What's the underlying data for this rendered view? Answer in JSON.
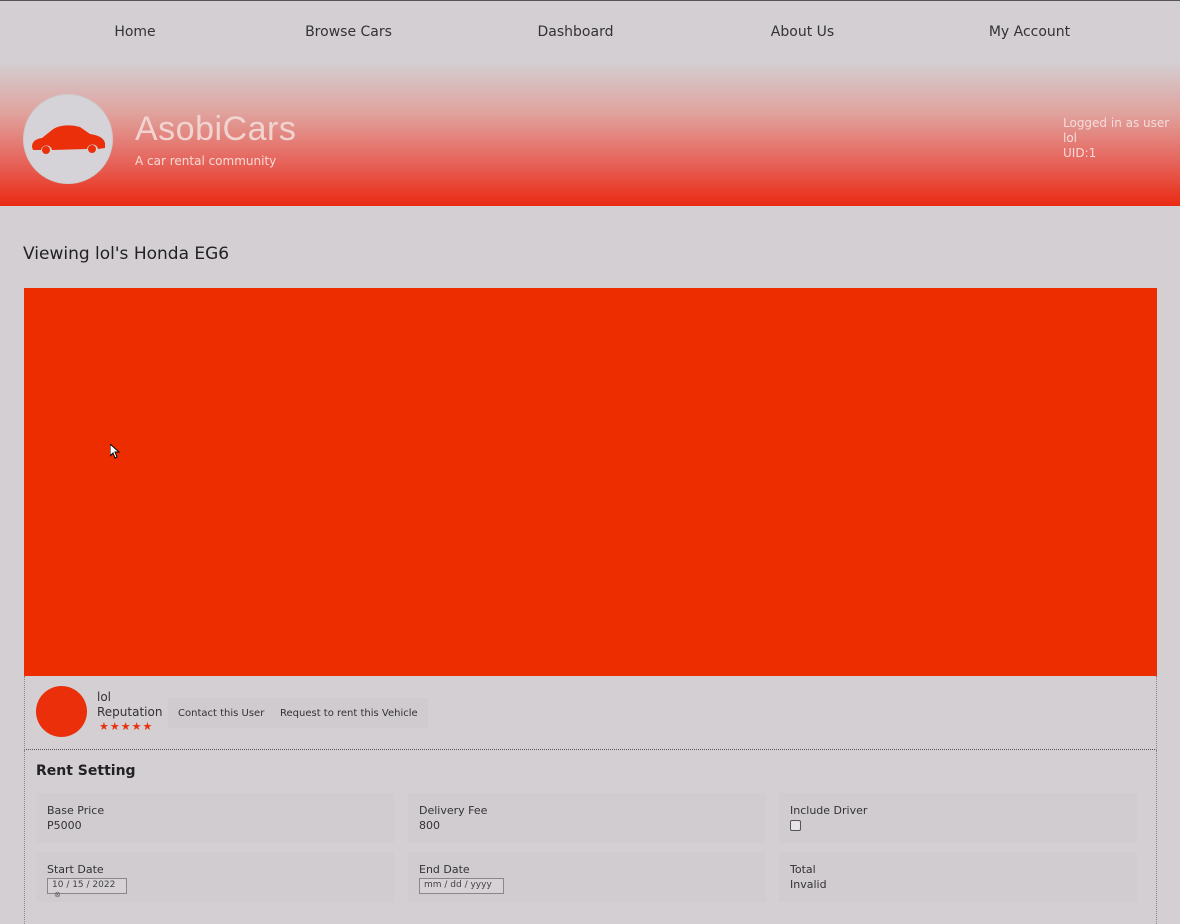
{
  "nav": {
    "items": [
      "Home",
      "Browse Cars",
      "Dashboard",
      "About Us",
      "My Account"
    ]
  },
  "brand": {
    "title": "AsobiCars",
    "tagline": "A car rental community",
    "logo_icon": "car-silhouette-icon"
  },
  "login": {
    "line1": "Logged in as user",
    "username": "lol",
    "uid": "UID:1"
  },
  "page": {
    "title": "Viewing lol's Honda EG6"
  },
  "owner": {
    "name": "lol",
    "reputation_label": "Reputation",
    "stars": "★★★★★",
    "contact_button": "Contact this User",
    "rent_button": "Request to rent this Vehicle"
  },
  "rent": {
    "title": "Rent Setting",
    "base_price_label": "Base Price",
    "base_price": "P5000",
    "delivery_fee_label": "Delivery Fee",
    "delivery_fee": "800",
    "include_driver_label": "Include Driver",
    "start_date_label": "Start Date",
    "start_date": "10 / 15 / 2022",
    "end_date_label": "End Date",
    "end_date_placeholder": "mm / dd / yyyy",
    "total_label": "Total",
    "total": "Invalid"
  },
  "colors": {
    "accent": "#ed2d00",
    "background": "#d3cfd3"
  }
}
